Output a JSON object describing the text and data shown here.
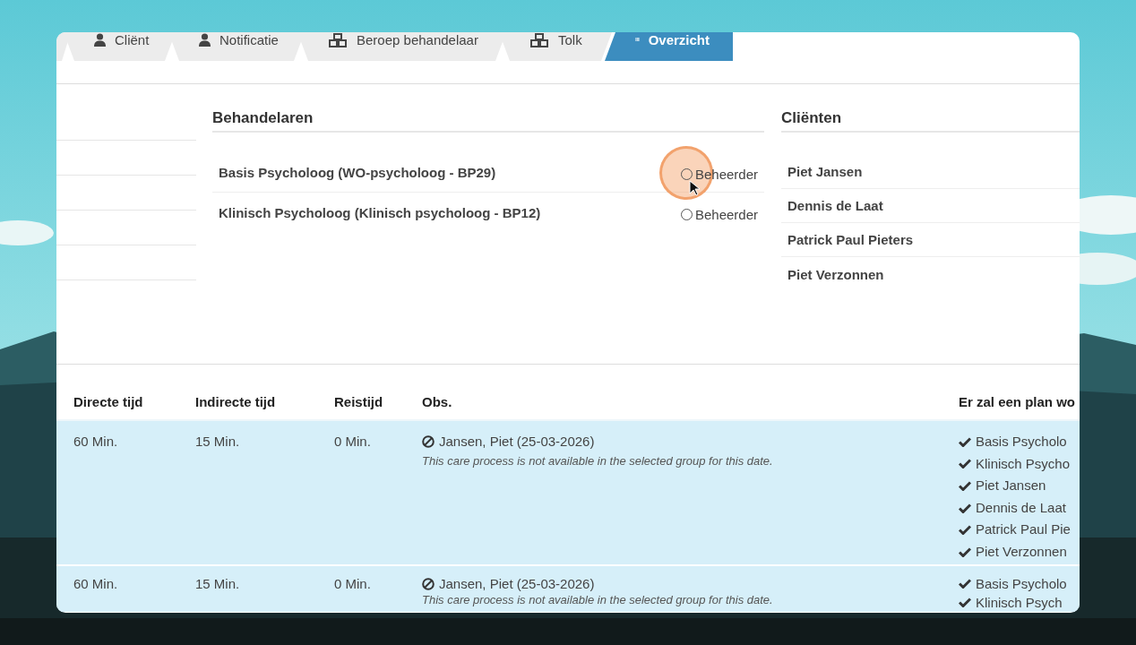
{
  "tabs": [
    {
      "label": "Cliënt",
      "kind": "user",
      "selected": false
    },
    {
      "label": "Notificatie",
      "kind": "user",
      "selected": false
    },
    {
      "label": "Beroep behandelaar",
      "kind": "cubes",
      "selected": false
    },
    {
      "label": "Tolk",
      "kind": "cubes",
      "selected": false
    },
    {
      "label": "Overzicht",
      "kind": "list",
      "selected": true
    }
  ],
  "behandelaren": {
    "title": "Behandelaren",
    "items": [
      {
        "name": "Basis Psycholoog (WO-psycholoog - BP29)",
        "option": "Beheerder",
        "selected": false
      },
      {
        "name": "Klinisch Psycholoog (Klinisch psycholoog - BP12)",
        "option": "Beheerder",
        "selected": false
      }
    ]
  },
  "clienten": {
    "title": "Cliënten",
    "items": [
      "Piet Jansen",
      "Dennis de Laat",
      "Patrick Paul Pieters",
      "Piet Verzonnen"
    ]
  },
  "table": {
    "columns": [
      "Directe tijd",
      "Indirecte tijd",
      "Reistijd",
      "Obs.",
      "Er zal een plan wo"
    ],
    "rows": [
      {
        "direct": "60 Min.",
        "indirect": "15 Min.",
        "travel": "0 Min.",
        "obs": "Jansen, Piet (25-03-2026)",
        "note": "This care process is not available in the selected group for this date.",
        "plan": [
          "Basis Psycholo",
          "Klinisch Psycho",
          "Piet Jansen",
          "Dennis de Laat",
          "Patrick Paul Pie",
          "Piet Verzonnen"
        ]
      },
      {
        "direct": "60 Min.",
        "indirect": "15 Min.",
        "travel": "0 Min.",
        "obs": "Jansen, Piet (25-03-2026)",
        "note": "This care process is not available in the selected group for this date.",
        "plan": [
          "Basis Psycholo",
          "Klinisch Psych"
        ]
      }
    ]
  }
}
